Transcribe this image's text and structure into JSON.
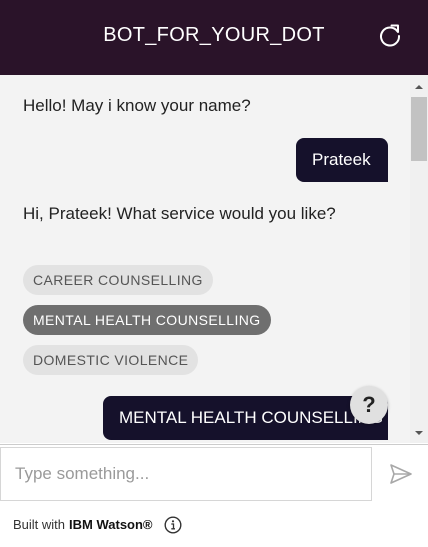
{
  "header": {
    "title": "BOT_FOR_YOUR_DOT",
    "reset_icon": "refresh-icon"
  },
  "messages": {
    "bot_greeting": "Hello! May i know your name?",
    "user_name": "Prateek",
    "bot_service_prompt": "Hi, Prateek! What service would you like?",
    "options": [
      "CAREER COUNSELLING",
      "MENTAL HEALTH COUNSELLING",
      "DOMESTIC VIOLENCE"
    ],
    "selected_option": "MENTAL HEALTH COUNSELLING",
    "user_reply": "MENTAL HEALTH COUNSELLING"
  },
  "help_button": {
    "label": "?"
  },
  "input": {
    "placeholder": "Type something...",
    "value": "",
    "send_icon": "send-icon"
  },
  "footer": {
    "built_with": "Built with",
    "brand": "IBM Watson®",
    "info_icon": "info-icon"
  },
  "colors": {
    "header_bg": "#2a1329",
    "user_bubble_bg": "#15112b",
    "chat_bg": "#f3f3f3",
    "selected_option_bg": "#6f6f6f"
  }
}
